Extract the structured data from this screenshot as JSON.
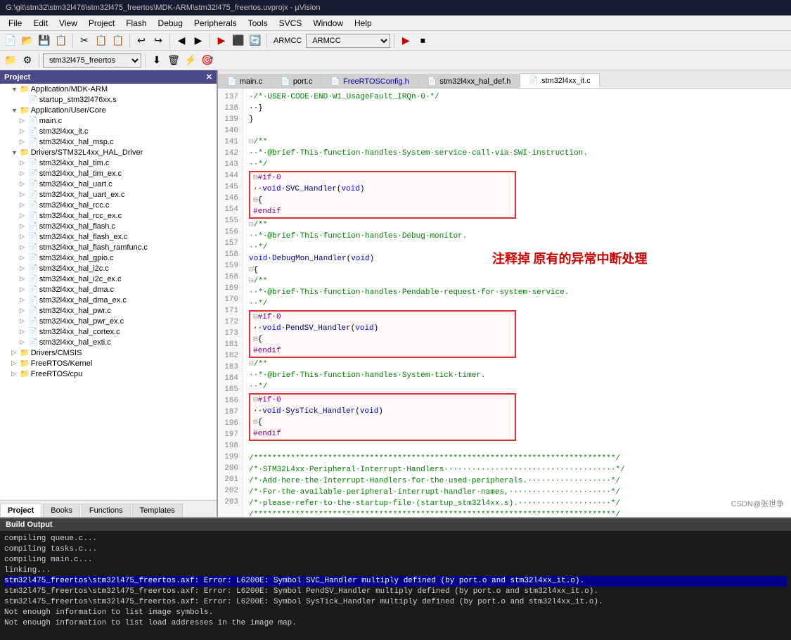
{
  "title_bar": {
    "text": "G:\\git\\stm32\\stm32l476\\stm32l475_freertos\\MDK-ARM\\stm32l475_freertos.uvprojx - µVision"
  },
  "menu": {
    "items": [
      "File",
      "Edit",
      "View",
      "Project",
      "Flash",
      "Debug",
      "Peripherals",
      "Tools",
      "SVCS",
      "Window",
      "Help"
    ]
  },
  "toolbar2": {
    "combo_value": "stm32l475_freertos",
    "armcc_value": "ARMCC"
  },
  "project_panel": {
    "header": "Project",
    "tree": [
      {
        "level": 1,
        "type": "folder",
        "label": "Application/MDK-ARM",
        "expanded": true
      },
      {
        "level": 2,
        "type": "file",
        "label": "startup_stm32l476xx.s"
      },
      {
        "level": 1,
        "type": "folder",
        "label": "Application/User/Core",
        "expanded": true
      },
      {
        "level": 2,
        "type": "file",
        "label": "main.c",
        "has_expand": true
      },
      {
        "level": 2,
        "type": "file",
        "label": "stm32l4xx_it.c",
        "has_expand": true
      },
      {
        "level": 2,
        "type": "file",
        "label": "stm32l4xx_hal_msp.c",
        "has_expand": true
      },
      {
        "level": 1,
        "type": "folder",
        "label": "Drivers/STM32L4xx_HAL_Driver",
        "expanded": true
      },
      {
        "level": 2,
        "type": "file",
        "label": "stm32l4xx_hal_tim.c",
        "has_expand": true
      },
      {
        "level": 2,
        "type": "file",
        "label": "stm32l4xx_hal_tim_ex.c",
        "has_expand": true
      },
      {
        "level": 2,
        "type": "file",
        "label": "stm32l4xx_hal_uart.c",
        "has_expand": true
      },
      {
        "level": 2,
        "type": "file",
        "label": "stm32l4xx_hal_uart_ex.c",
        "has_expand": true
      },
      {
        "level": 2,
        "type": "file",
        "label": "stm32l4xx_hal_rcc.c",
        "has_expand": true
      },
      {
        "level": 2,
        "type": "file",
        "label": "stm32l4xx_hal_rcc_ex.c",
        "has_expand": true
      },
      {
        "level": 2,
        "type": "file",
        "label": "stm32l4xx_hal_flash.c",
        "has_expand": true
      },
      {
        "level": 2,
        "type": "file",
        "label": "stm32l4xx_hal_flash_ex.c",
        "has_expand": true
      },
      {
        "level": 2,
        "type": "file",
        "label": "stm32l4xx_hal_flash_ramfunc.c",
        "has_expand": true
      },
      {
        "level": 2,
        "type": "file",
        "label": "stm32l4xx_hal_gpio.c",
        "has_expand": true
      },
      {
        "level": 2,
        "type": "file",
        "label": "stm32l4xx_hal_i2c.c",
        "has_expand": true
      },
      {
        "level": 2,
        "type": "file",
        "label": "stm32l4xx_hal_i2c_ex.c",
        "has_expand": true
      },
      {
        "level": 2,
        "type": "file",
        "label": "stm32l4xx_hal_dma.c",
        "has_expand": true
      },
      {
        "level": 2,
        "type": "file",
        "label": "stm32l4xx_hal_dma_ex.c",
        "has_expand": true
      },
      {
        "level": 2,
        "type": "file",
        "label": "stm32l4xx_hal_pwr.c",
        "has_expand": true
      },
      {
        "level": 2,
        "type": "file",
        "label": "stm32l4xx_hal_pwr_ex.c",
        "has_expand": true
      },
      {
        "level": 2,
        "type": "file",
        "label": "stm32l4xx_hal_cortex.c",
        "has_expand": true
      },
      {
        "level": 2,
        "type": "file",
        "label": "stm32l4xx_hal_exti.c",
        "has_expand": true
      },
      {
        "level": 1,
        "type": "folder",
        "label": "Drivers/CMSIS",
        "expanded": false
      },
      {
        "level": 1,
        "type": "folder",
        "label": "FreeRTOS/Kernel",
        "expanded": false
      },
      {
        "level": 1,
        "type": "folder",
        "label": "FreeRTOS/cpu",
        "expanded": false
      }
    ],
    "tabs": [
      "Project",
      "Books",
      "Functions",
      "Templates"
    ]
  },
  "file_tabs": [
    {
      "label": "main.c",
      "active": false
    },
    {
      "label": "port.c",
      "active": false
    },
    {
      "label": "FreeRTOSConfig.h",
      "active": false,
      "modified": true
    },
    {
      "label": "stm32l4xx_hal_def.h",
      "active": false
    },
    {
      "label": "stm32l4xx_it.c",
      "active": true
    }
  ],
  "code": {
    "lines": [
      {
        "num": 137,
        "text": "  /* USER CODE END W1_UsageFault_IRQn 0 */"
      },
      {
        "num": 138,
        "text": "  }"
      },
      {
        "num": 139,
        "text": "}"
      },
      {
        "num": 140,
        "text": ""
      },
      {
        "num": 141,
        "text": "/**",
        "collapse": true
      },
      {
        "num": 142,
        "text": "  * @brief  This function handles System service call via SWI instruction."
      },
      {
        "num": 143,
        "text": "  */"
      },
      {
        "num": 144,
        "text": "#if 0",
        "box_start": true
      },
      {
        "num": 145,
        "text": "void SVC_Handler(void)"
      },
      {
        "num": 146,
        "text": "{",
        "collapse": true
      },
      {
        "num": 154,
        "text": "#endif",
        "box_end": true
      },
      {
        "num": 155,
        "text": "/**",
        "collapse": true
      },
      {
        "num": 156,
        "text": "  * @brief  This function handles Debug monitor."
      },
      {
        "num": 157,
        "text": "  */"
      },
      {
        "num": 158,
        "text": "void DebugMon_Handler(void)"
      },
      {
        "num": 159,
        "text": "{",
        "collapse": true
      },
      {
        "num": 168,
        "text": "/**",
        "collapse": true
      },
      {
        "num": 169,
        "text": "  * @brief  This function handles Pendable request for system service."
      },
      {
        "num": 170,
        "text": "  */"
      },
      {
        "num": 171,
        "text": "#if 0",
        "box2_start": true
      },
      {
        "num": 172,
        "text": "void PendSV_Handler(void)"
      },
      {
        "num": 173,
        "text": "{",
        "collapse": true
      },
      {
        "num": 181,
        "text": "#endif",
        "box2_end": true
      },
      {
        "num": 182,
        "text": "/**",
        "collapse": true
      },
      {
        "num": 183,
        "text": "  * @brief  This function handles System tick timer."
      },
      {
        "num": 184,
        "text": "  */"
      },
      {
        "num": 185,
        "text": "#if 0",
        "box3_start": true
      },
      {
        "num": 186,
        "text": "void SysTick_Handler(void)"
      },
      {
        "num": 187,
        "text": "{",
        "collapse": true
      },
      {
        "num": 196,
        "text": "#endif",
        "box3_end": true
      },
      {
        "num": 197,
        "text": ""
      },
      {
        "num": 198,
        "text": "/*************************************************************************/"
      },
      {
        "num": 199,
        "text": "/* STM32L4xx Peripheral Interrupt Handlers                              */"
      },
      {
        "num": 200,
        "text": "/* Add here the Interrupt Handlers for the used peripherals.            */"
      },
      {
        "num": 201,
        "text": "/* For the available peripheral interrupt handler names,                */"
      },
      {
        "num": 202,
        "text": "/* please refer to the startup file (startup_stm32l4xx.s).              */"
      },
      {
        "num": 203,
        "text": "/*************************************************************************/"
      }
    ]
  },
  "annotation": {
    "text": "注释掉 原有的异常中断处理"
  },
  "build_output": {
    "header": "Build Output",
    "lines": [
      {
        "text": "compiling queue.c...",
        "type": "normal"
      },
      {
        "text": "compiling tasks.c...",
        "type": "normal"
      },
      {
        "text": "compiling main.c...",
        "type": "normal"
      },
      {
        "text": "linking...",
        "type": "normal"
      },
      {
        "text": "stm32l475_freertos\\stm32l475_freertos.axf: Error: L6200E: Symbol SVC_Handler multiply defined (by port.o and stm32l4xx_it.o).",
        "type": "error"
      },
      {
        "text": "stm32l475_freertos\\stm32l475_freertos.axf: Error: L6200E: Symbol PendSV_Handler multiply defined (by port.o and stm32l4xx_it.o).",
        "type": "normal"
      },
      {
        "text": "stm32l475_freertos\\stm32l475_freertos.axf: Error: L6200E: Symbol SysTick_Handler multiply defined (by port.o and stm32l4xx_it.o).",
        "type": "normal"
      },
      {
        "text": "Not enough information to list image symbols.",
        "type": "normal"
      },
      {
        "text": "Not enough information to list load addresses in the image map.",
        "type": "normal"
      }
    ]
  },
  "watermark": "CSDN@张世争"
}
